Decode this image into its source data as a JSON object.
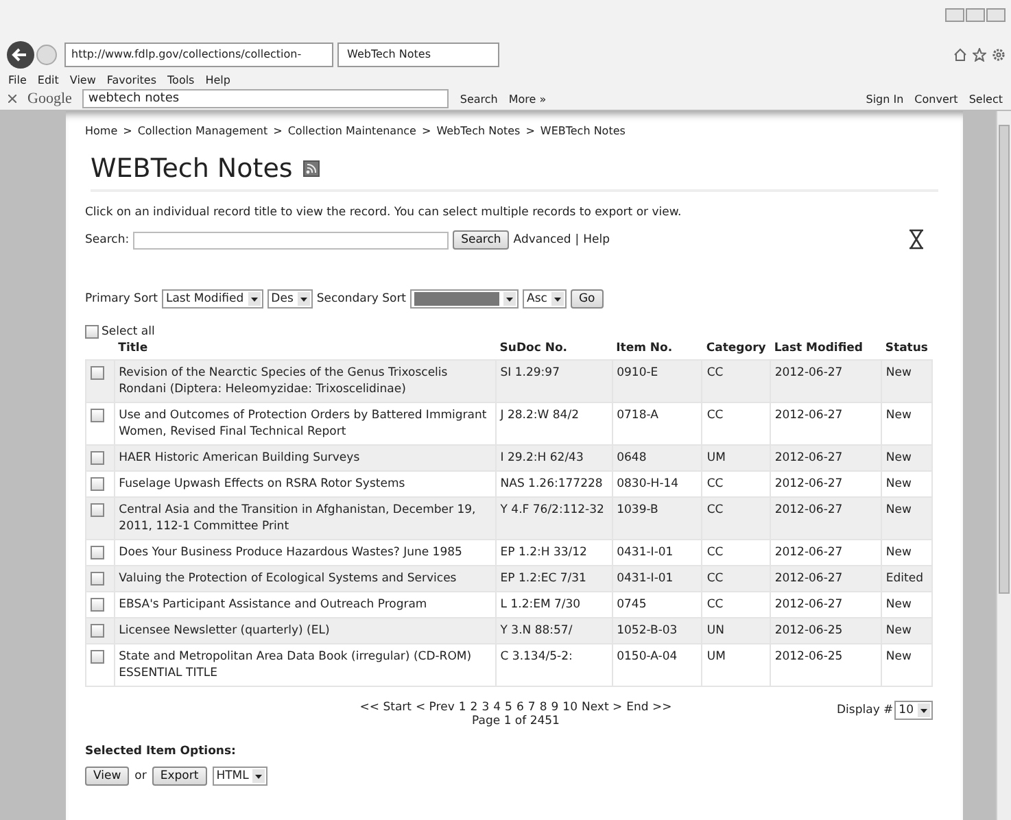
{
  "browser": {
    "address": "http://www.fdlp.gov/collections/collection-",
    "tab_title": "WebTech Notes",
    "menu": [
      "File",
      "Edit",
      "View",
      "Favorites",
      "Tools",
      "Help"
    ],
    "toolbar": {
      "brand": "Google",
      "query": "webtech notes",
      "search_label": "Search",
      "more": "More »",
      "sign_in": "Sign In",
      "convert": "Convert",
      "select": "Select"
    }
  },
  "breadcrumb": [
    "Home",
    "Collection Management",
    "Collection Maintenance",
    "WebTech Notes",
    "WEBTech Notes"
  ],
  "breadcrumb_separator": ">",
  "heading": "WEBTech Notes",
  "intro": "Click on an individual record title to view the record. You can select multiple records to export or view.",
  "search": {
    "label": "Search:",
    "button": "Search",
    "links": [
      "Advanced",
      "Help"
    ],
    "separator": "|"
  },
  "sort": {
    "primary_label": "Primary Sort",
    "primary": "Last Modified",
    "primary_order": "Des",
    "secondary_label": "Secondary Sort",
    "secondary_order": "Asc",
    "go": "Go"
  },
  "select_all": {
    "label": "Select all",
    "checked": false
  },
  "table": {
    "columns": [
      "Title",
      "SuDoc No.",
      "Item No.",
      "Category",
      "Last Modified",
      "Status"
    ],
    "rows": [
      {
        "checked": false,
        "cells": [
          "Revision of the Nearctic Species of the Genus Trixoscelis Rondani (Diptera: Heleomyzidae: Trixoscelidinae)",
          "SI 1.29:97",
          "0910-E",
          "CC",
          "2012-06-27",
          "New"
        ]
      },
      {
        "checked": false,
        "cells": [
          "Use and Outcomes of Protection Orders by Battered Immigrant Women, Revised Final Technical Report",
          "J 28.2:W 84/2",
          "0718-A",
          "CC",
          "2012-06-27",
          "New"
        ]
      },
      {
        "checked": false,
        "cells": [
          "HAER Historic American Building Surveys",
          "I 29.2:H 62/43",
          "0648",
          "UM",
          "2012-06-27",
          "New"
        ]
      },
      {
        "checked": false,
        "cells": [
          "Fuselage Upwash Effects on RSRA Rotor Systems",
          "NAS 1.26:177228",
          "0830-H-14",
          "CC",
          "2012-06-27",
          "New"
        ]
      },
      {
        "checked": false,
        "cells": [
          "Central Asia and the Transition in Afghanistan, December 19, 2011, 112-1 Committee Print",
          "Y 4.F 76/2:112-32",
          "1039-B",
          "CC",
          "2012-06-27",
          "New"
        ]
      },
      {
        "checked": false,
        "cells": [
          "Does Your Business Produce Hazardous Wastes? June 1985",
          "EP 1.2:H 33/12",
          "0431-I-01",
          "CC",
          "2012-06-27",
          "New"
        ]
      },
      {
        "checked": false,
        "cells": [
          "Valuing the Protection of Ecological Systems and Services",
          "EP 1.2:EC 7/31",
          "0431-I-01",
          "CC",
          "2012-06-27",
          "Edited"
        ]
      },
      {
        "checked": false,
        "cells": [
          "EBSA's Participant Assistance and Outreach Program",
          "L 1.2:EM 7/30",
          "0745",
          "CC",
          "2012-06-27",
          "New"
        ]
      },
      {
        "checked": false,
        "cells": [
          "Licensee Newsletter (quarterly) (EL)",
          "Y 3.N 88:57/",
          "1052-B-03",
          "UN",
          "2012-06-25",
          "New"
        ]
      },
      {
        "checked": false,
        "cells": [
          "State and Metropolitan Area Data Book (irregular) (CD-ROM) ESSENTIAL TITLE",
          "C 3.134/5-2:",
          "0150-A-04",
          "UM",
          "2012-06-25",
          "New"
        ]
      }
    ]
  },
  "pager": {
    "links": [
      "<< Start",
      "< Prev",
      "1",
      "2",
      "3",
      "4",
      "5",
      "6",
      "7",
      "8",
      "9",
      "10",
      "Next >",
      "End >>"
    ],
    "page": "Page 1 of 2451",
    "display_label": "Display #",
    "display": "10"
  },
  "options": {
    "label": "Selected Item Options:",
    "view": "View",
    "or": "or",
    "export": "Export",
    "format": "HTML"
  }
}
